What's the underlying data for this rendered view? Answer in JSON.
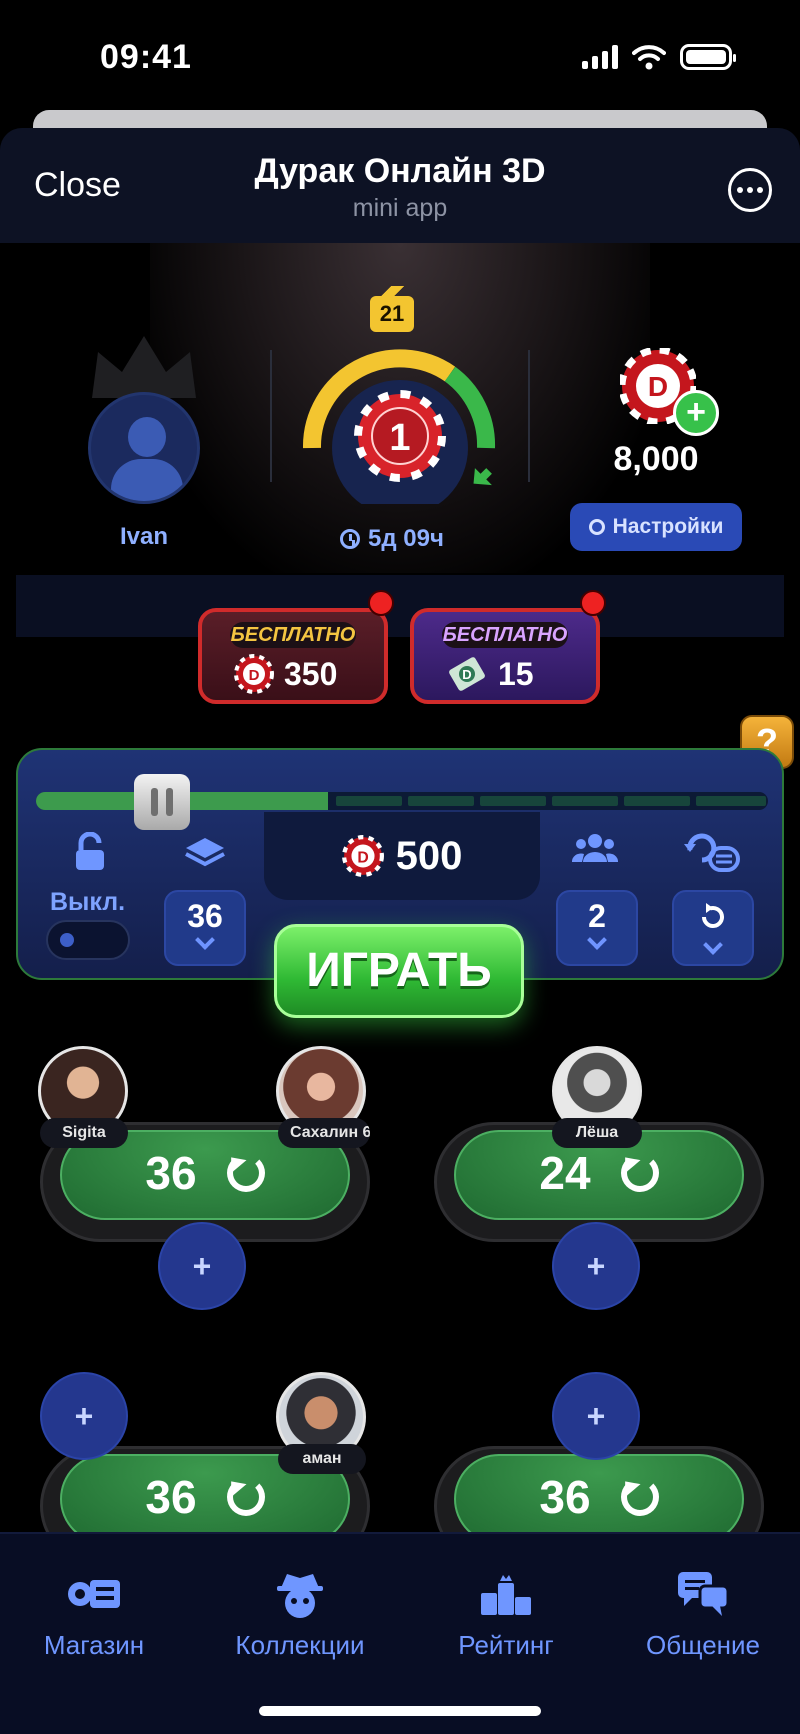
{
  "status_bar": {
    "time": "09:41"
  },
  "header": {
    "close_label": "Close",
    "title": "Дурак Онлайн 3D",
    "subtitle": "mini app"
  },
  "profile": {
    "username": "Ivan",
    "level": "21",
    "rank": "1",
    "timer": "5д 09ч",
    "balance": "8,000",
    "settings_label": "Настройки"
  },
  "promos": [
    {
      "label": "БЕСПЛАТНО",
      "value": "350",
      "icon": "chip-icon"
    },
    {
      "label": "БЕСПЛАТНО",
      "value": "15",
      "icon": "ticket-icon"
    }
  ],
  "game_setup": {
    "stake": "500",
    "lock_label": "Выкл.",
    "deck_size": "36",
    "players": "2",
    "play_label": "ИГРАТЬ"
  },
  "tables": [
    {
      "deck": "36",
      "players": [
        "Sigita",
        "Сахалин 6"
      ]
    },
    {
      "deck": "24",
      "players": [
        "Лёша"
      ]
    },
    {
      "deck": "36",
      "players": [
        "аман"
      ]
    },
    {
      "deck": "36",
      "players": []
    }
  ],
  "nav": {
    "items": [
      {
        "label": "Магазин",
        "icon": "shop-icon"
      },
      {
        "label": "Коллекции",
        "icon": "collections-icon"
      },
      {
        "label": "Рейтинг",
        "icon": "rating-icon"
      },
      {
        "label": "Общение",
        "icon": "chat-icon"
      }
    ]
  },
  "colors": {
    "accent": "#6f96ff",
    "play": "#2fb934",
    "gold": "#f3c530",
    "danger": "#d02b2b"
  }
}
